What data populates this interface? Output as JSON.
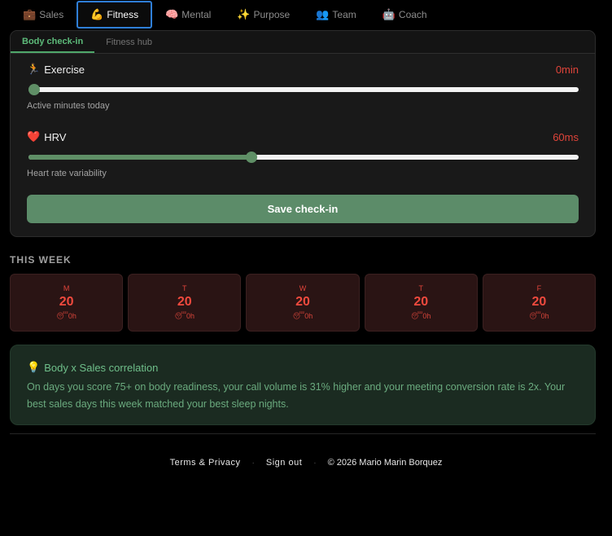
{
  "nav": {
    "tabs": [
      {
        "icon": "💼",
        "label": "Sales"
      },
      {
        "icon": "💪",
        "label": "Fitness"
      },
      {
        "icon": "🧠",
        "label": "Mental"
      },
      {
        "icon": "✨",
        "label": "Purpose"
      },
      {
        "icon": "👥",
        "label": "Team"
      },
      {
        "icon": "🤖",
        "label": "Coach"
      }
    ],
    "active_index": 1
  },
  "subtabs": {
    "body_checkin": "Body check-in",
    "fitness_hub": "Fitness hub"
  },
  "exercise": {
    "icon": "🏃",
    "label": "Exercise",
    "value_text": "0min",
    "level": 0,
    "description": "Active minutes today"
  },
  "hrv": {
    "icon": "❤️",
    "label": "HRV",
    "value_text": "60ms",
    "level": 0.4,
    "description": "Heart rate variability"
  },
  "save_label": "Save check-in",
  "week": {
    "title": "THIS WEEK",
    "days": [
      {
        "letter": "M",
        "score": "20",
        "sleep_icon": "😴",
        "sleep": "0h"
      },
      {
        "letter": "T",
        "score": "20",
        "sleep_icon": "😴",
        "sleep": "0h"
      },
      {
        "letter": "W",
        "score": "20",
        "sleep_icon": "😴",
        "sleep": "0h"
      },
      {
        "letter": "T",
        "score": "20",
        "sleep_icon": "😴",
        "sleep": "0h"
      },
      {
        "letter": "F",
        "score": "20",
        "sleep_icon": "😴",
        "sleep": "0h"
      }
    ]
  },
  "insight": {
    "icon": "💡",
    "title": "Body x Sales correlation",
    "text": "On days you score 75+ on body readiness, your call volume is 31% higher and your meeting conversion rate is 2x. Your best sales days this week matched your best sleep nights."
  },
  "footer": {
    "terms": "Terms & Privacy",
    "signout": "Sign out",
    "copyright": "© 2026 Mario Marin Borquez"
  },
  "colors": {
    "accent_green": "#5c8c69",
    "alert_red": "#e0443a",
    "active_tab_border": "#2f7fd8"
  }
}
